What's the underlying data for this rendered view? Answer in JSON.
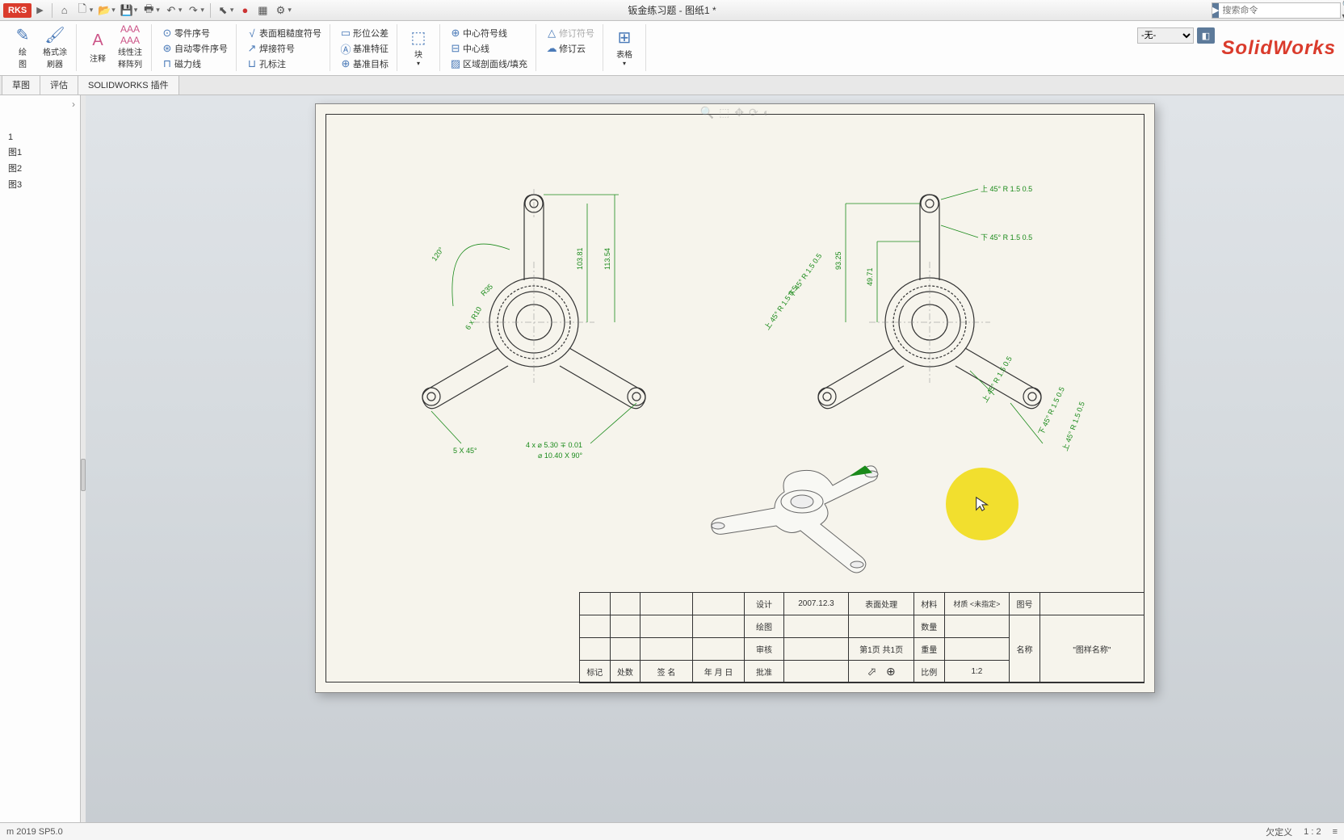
{
  "app": {
    "doc_title": "钣金练习题 - 图纸1 *",
    "brand": "SolidWorks",
    "search_placeholder": "搜索命令"
  },
  "toolbar_icons": [
    "home",
    "new",
    "open",
    "save",
    "print",
    "undo",
    "redo",
    "select",
    "rebuild",
    "options",
    "settings"
  ],
  "ribbon": {
    "groups": {
      "g0": {
        "btn0": "绘\n图",
        "btn1": "格式涂\n刷器"
      },
      "g1": {
        "btn0": "注释",
        "btn1": "线性注\n释阵列"
      },
      "g2": {
        "r0": "零件序号",
        "r1": "自动零件序号",
        "r2": "磁力线"
      },
      "g3": {
        "r0": "表面粗糙度符号",
        "r1": "焊接符号",
        "r2": "孔标注"
      },
      "g4": {
        "r0": "形位公差",
        "r1": "基准特征",
        "r2": "基准目标"
      },
      "g5": {
        "btn0": "块"
      },
      "g6": {
        "r0": "中心符号线",
        "r1": "中心线",
        "r2": "区域剖面线/填充"
      },
      "g7": {
        "r0": "修订符号",
        "r1": "修订云"
      },
      "g8": {
        "btn0": "表格"
      }
    },
    "layer": {
      "none": "-无-"
    }
  },
  "tabs": {
    "t0": "草图",
    "t1": "评估",
    "t2": "SOLIDWORKS 插件"
  },
  "tree": {
    "item0": "1",
    "item1": "图1",
    "item2": "图2",
    "item3": "图3"
  },
  "drawing": {
    "left": {
      "angle120": "120°",
      "r35": "R35",
      "r10": "6 x R10",
      "dim1": "103.81",
      "dim2": "113.54",
      "chamfer": "5 X 45°",
      "hole_note1": "4 x ⌀ 5.30 ∓ 0.01",
      "hole_note2": "⌀ 10.40 X 90°"
    },
    "right": {
      "note_up": "上   45°    R 1.5  0.5",
      "note_down": "下   45°    R 1.5  0.5",
      "dim1": "93.25",
      "dim2": "49.71",
      "bend1": "下 45° R 1.5 0.5",
      "bend2": "上 45° R 1.5 0.5",
      "bend3": "上 45° R 1.5 0.5",
      "bend4": "下 45° R 1.5 0.5",
      "bend5": "上 45° R 1.5 0.5"
    }
  },
  "title_block": {
    "r1": {
      "c5": "设计",
      "c6": "2007.12.3",
      "c7": "表面处理",
      "c8": "材料",
      "c9": "材质 <未指定>",
      "c10": "图号"
    },
    "r2": {
      "c5": "绘图",
      "c8": "数量",
      "c10": "名称",
      "c11": "\"图样名称\""
    },
    "r3": {
      "c5": "审核",
      "c7": "第1页 共1页",
      "c8": "重量"
    },
    "r4": {
      "c1": "标记",
      "c2": "处数",
      "c3": "签 名",
      "c4": "年 月 日",
      "c5": "批准",
      "c8": "比例",
      "c9": "1:2"
    }
  },
  "status": {
    "left": "m 2019 SP5.0",
    "under_defined": "欠定义",
    "ratio": "1 : 2"
  }
}
